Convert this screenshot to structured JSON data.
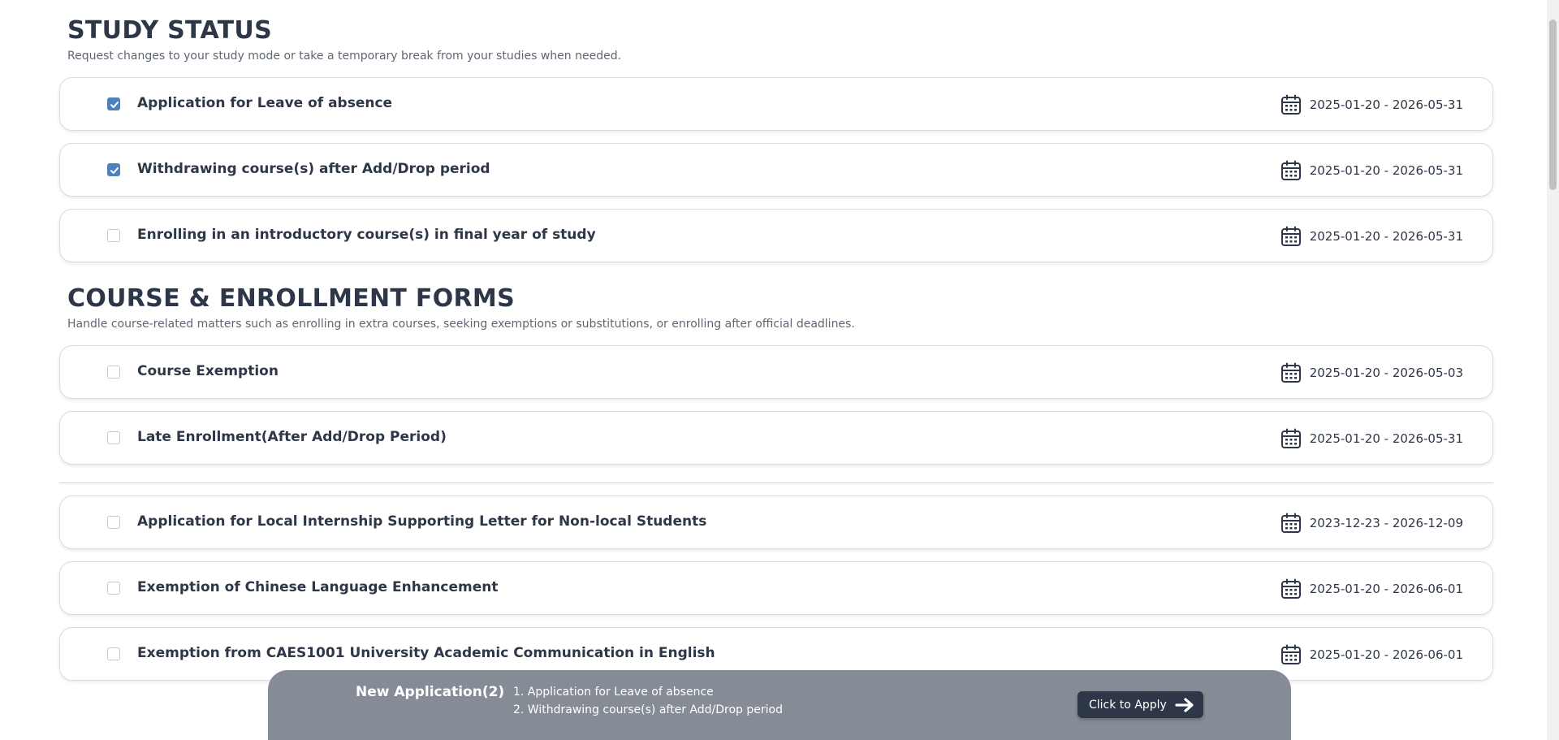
{
  "sections": [
    {
      "heading": "STUDY STATUS",
      "subtitle": "Request changes to your study mode or take a temporary break from your studies when needed."
    },
    {
      "heading": "COURSE & ENROLLMENT FORMS",
      "subtitle": "Handle course-related matters such as enrolling in extra courses, seeking exemptions or substitutions, or enrolling after official deadlines."
    }
  ],
  "forms": [
    {
      "title": "Application for Leave of absence",
      "date": "2025-01-20 - 2026-05-31",
      "checked": true
    },
    {
      "title": "Withdrawing course(s) after Add/Drop period",
      "date": "2025-01-20 - 2026-05-31",
      "checked": true
    },
    {
      "title": "Enrolling in an introductory course(s) in final year of study",
      "date": "2025-01-20 - 2026-05-31",
      "checked": false
    },
    {
      "title": "Course Exemption",
      "date": "2025-01-20 - 2026-05-03",
      "checked": false
    },
    {
      "title": "Late Enrollment(After Add/Drop Period)",
      "date": "2025-01-20 - 2026-05-31",
      "checked": false
    },
    {
      "title": "Application for Local Internship Supporting Letter for Non-local Students",
      "date": "2023-12-23 - 2026-12-09",
      "checked": false
    },
    {
      "title": "Exemption of Chinese Language Enhancement",
      "date": "2025-01-20 - 2026-06-01",
      "checked": false
    },
    {
      "title": "Exemption from CAES1001 University Academic Communication in English",
      "date": "2025-01-20 - 2026-06-01",
      "checked": false
    }
  ],
  "apply_bar": {
    "title": "New Application(2)",
    "items": [
      "1. Application for Leave of absence",
      "2. Withdrawing course(s) after Add/Drop period"
    ],
    "button_label": "Click to Apply",
    "button_icon": "arrow-right-icon"
  },
  "icons": {
    "date": "calendar-icon",
    "checkbox": "check-icon"
  },
  "colors": {
    "checkbox_checked": "#4f81bd",
    "heading": "#2d3748",
    "apply_bar": "#868c96",
    "apply_button": "#2d3748"
  }
}
